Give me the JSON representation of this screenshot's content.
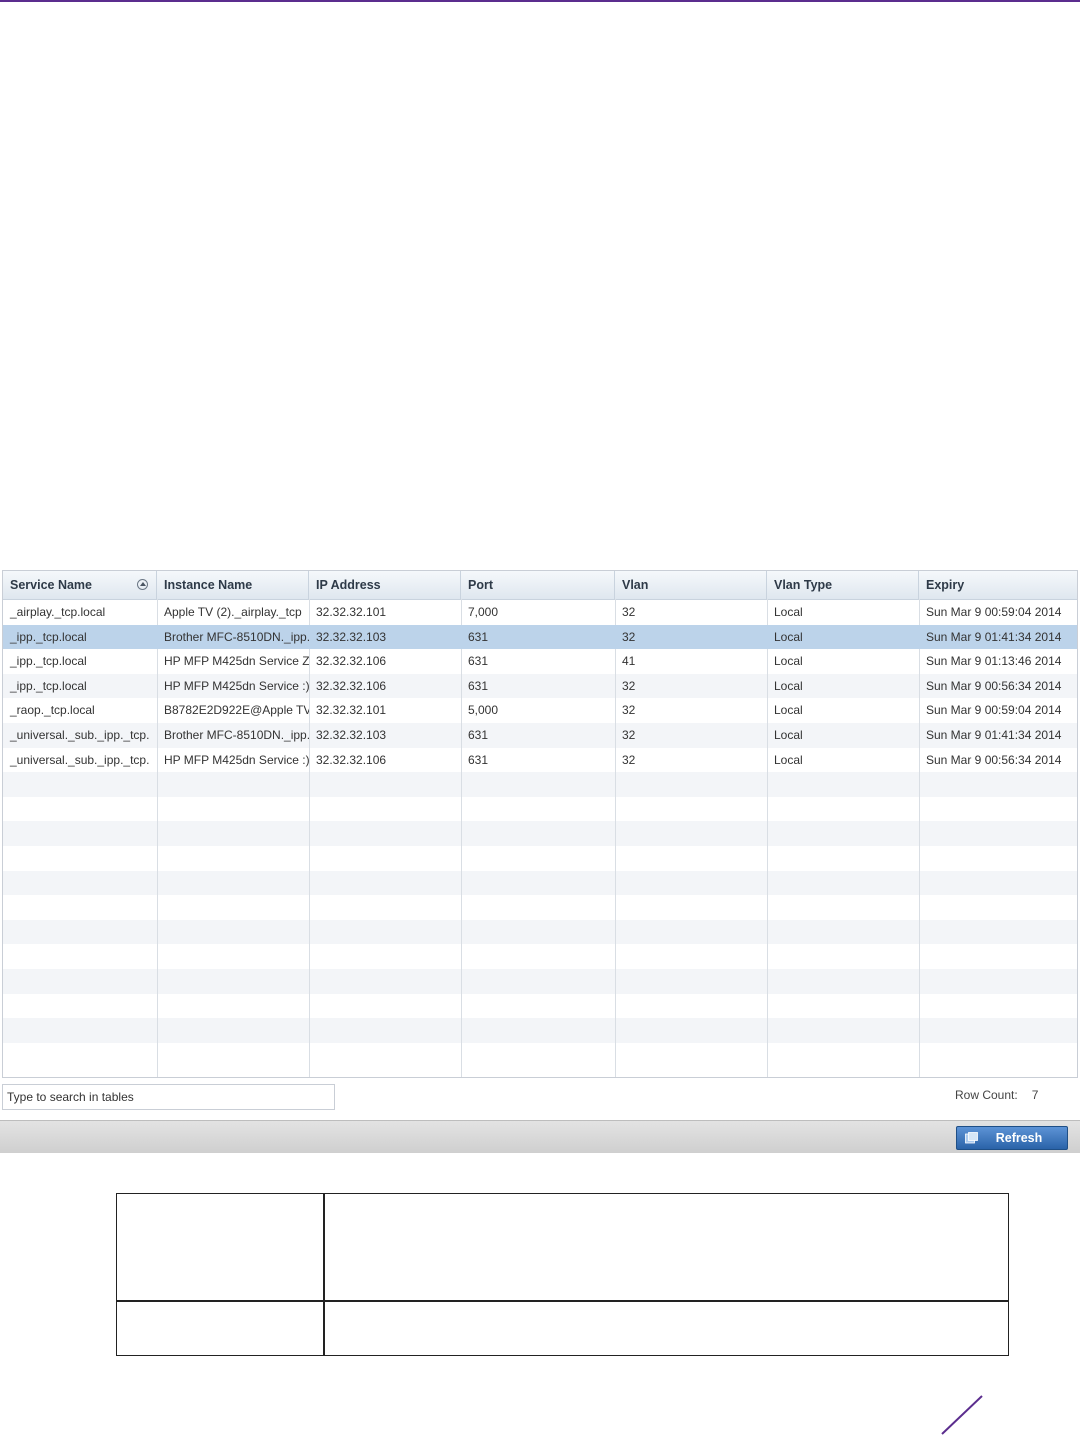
{
  "colors": {
    "accent": "#5b2d8e",
    "selected_row": "#bcd3ea",
    "button": "#3a75c0"
  },
  "table": {
    "columns": [
      "Service Name",
      "Instance Name",
      "IP Address",
      "Port",
      "Vlan",
      "Vlan Type",
      "Expiry"
    ],
    "sorted_column": "Service Name",
    "rows": [
      [
        "_airplay._tcp.local",
        "Apple TV (2)._airplay._tcp",
        "32.32.32.101",
        "7,000",
        "32",
        "Local",
        "Sun Mar  9 00:59:04 2014"
      ],
      [
        "_ipp._tcp.local",
        "Brother MFC-8510DN._ipp.",
        "32.32.32.103",
        "631",
        "32",
        "Local",
        "Sun Mar  9 01:41:34 2014"
      ],
      [
        "_ipp._tcp.local",
        "HP MFP M425dn Service Z",
        "32.32.32.106",
        "631",
        "41",
        "Local",
        "Sun Mar  9 01:13:46 2014"
      ],
      [
        "_ipp._tcp.local",
        "HP MFP M425dn Service :)",
        "32.32.32.106",
        "631",
        "32",
        "Local",
        "Sun Mar  9 00:56:34 2014"
      ],
      [
        "_raop._tcp.local",
        "B8782E2D922E@Apple TV",
        "32.32.32.101",
        "5,000",
        "32",
        "Local",
        "Sun Mar  9 00:59:04 2014"
      ],
      [
        "_universal._sub._ipp._tcp.",
        "Brother MFC-8510DN._ipp.",
        "32.32.32.103",
        "631",
        "32",
        "Local",
        "Sun Mar  9 01:41:34 2014"
      ],
      [
        "_universal._sub._ipp._tcp.",
        "HP MFP M425dn Service :)",
        "32.32.32.106",
        "631",
        "32",
        "Local",
        "Sun Mar  9 00:56:34 2014"
      ]
    ],
    "selected_row_index": 1
  },
  "search": {
    "placeholder": "Type to search in tables"
  },
  "row_count": {
    "label": "Row Count:",
    "value": "7"
  },
  "footer": {
    "refresh_label": "Refresh"
  }
}
